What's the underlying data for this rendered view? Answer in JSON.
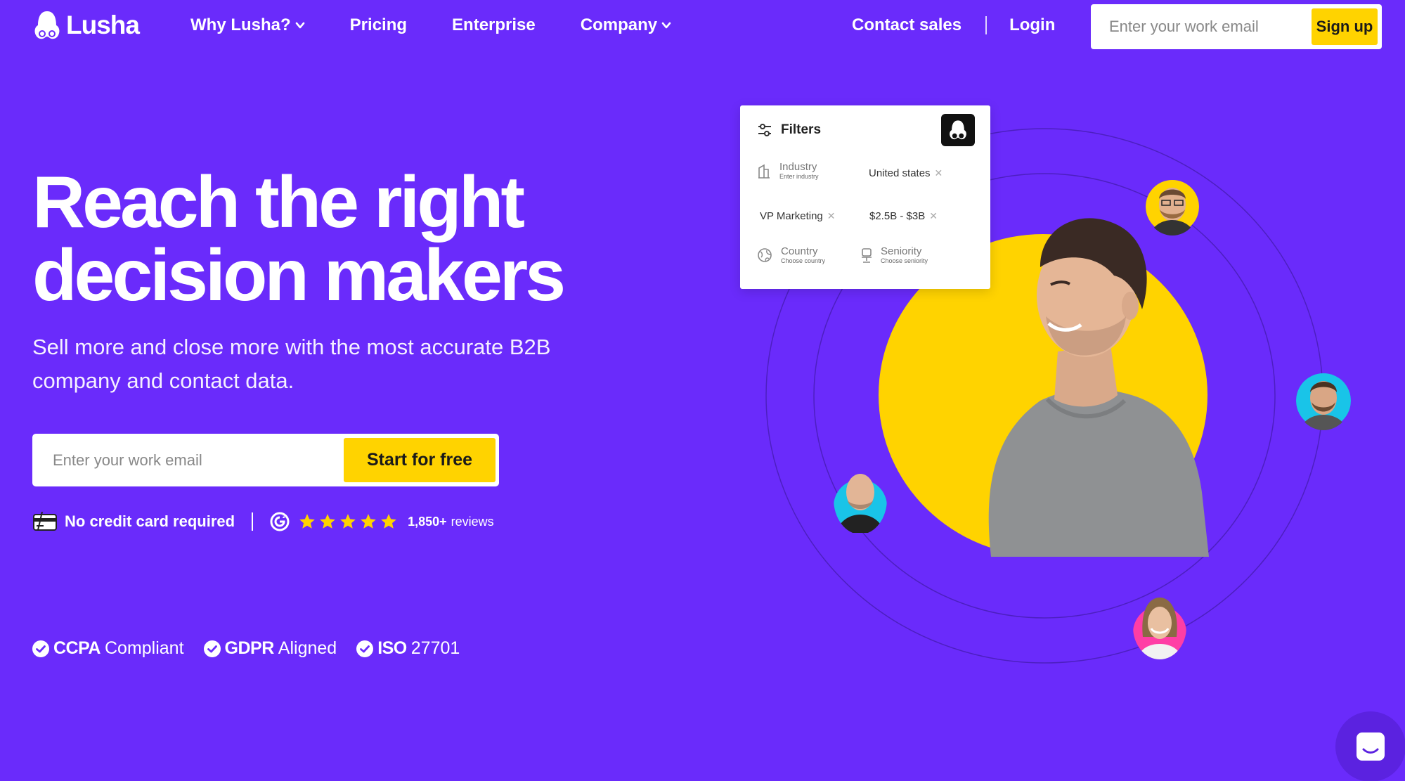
{
  "brand": {
    "name": "Lusha",
    "accent": "#6a2bfb",
    "yellow": "#ffd300"
  },
  "nav": {
    "links": [
      {
        "label": "Why Lusha?",
        "dropdown": true
      },
      {
        "label": "Pricing",
        "dropdown": false
      },
      {
        "label": "Enterprise",
        "dropdown": false
      },
      {
        "label": "Company",
        "dropdown": true
      }
    ],
    "contact_sales": "Contact sales",
    "login": "Login",
    "email_placeholder": "Enter your work email",
    "signup": "Sign up"
  },
  "hero": {
    "title_line1": "Reach the right",
    "title_line2": "decision makers",
    "subtitle_line1": "Sell more and close more with the most accurate B2B",
    "subtitle_line2": "company and contact data.",
    "email_placeholder": "Enter your work email",
    "cta": "Start for free"
  },
  "trust": {
    "no_card": "No credit card required",
    "rating_stars": 5,
    "reviews_count": "1,850+",
    "reviews_label": "reviews"
  },
  "compliance": [
    {
      "strong": "CCPA",
      "light": "Compliant"
    },
    {
      "strong": "GDPR",
      "light": "Aligned"
    },
    {
      "strong": "ISO",
      "light": "27701"
    }
  ],
  "filters_card": {
    "title": "Filters",
    "industry_label": "Industry",
    "industry_hint": "Enter industry",
    "chip_location": "United states",
    "chip_role": "VP Marketing",
    "chip_revenue": "$2.5B - $3B",
    "country_label": "Country",
    "country_hint": "Choose country",
    "seniority_label": "Seniority",
    "seniority_hint": "Choose seniority"
  }
}
